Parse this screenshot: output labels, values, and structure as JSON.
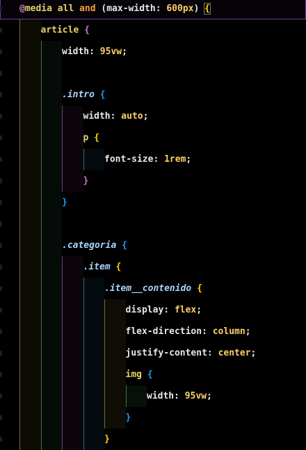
{
  "editor": {
    "lines": [
      {
        "indent": 0,
        "tokens": [
          {
            "t": "@",
            "c": "tk-at"
          },
          {
            "t": "media",
            "c": "tk-kw"
          },
          {
            "t": " ",
            "c": "tk-plain"
          },
          {
            "t": "all",
            "c": "tk-kw"
          },
          {
            "t": " ",
            "c": "tk-plain"
          },
          {
            "t": "and",
            "c": "tk-and"
          },
          {
            "t": " (",
            "c": "tk-plain"
          },
          {
            "t": "max-width",
            "c": "tk-prop"
          },
          {
            "t": ": ",
            "c": "tk-colon"
          },
          {
            "t": "600",
            "c": "tk-num"
          },
          {
            "t": "px",
            "c": "tk-num"
          },
          {
            "t": ") ",
            "c": "tk-plain"
          },
          {
            "t": "{",
            "c": "br-y br-highlight"
          }
        ],
        "active": true
      },
      {
        "indent": 1,
        "tokens": [
          {
            "t": "article",
            "c": "tk-tag"
          },
          {
            "t": " ",
            "c": "tk-plain"
          },
          {
            "t": "{",
            "c": "br-p"
          }
        ]
      },
      {
        "indent": 2,
        "tokens": [
          {
            "t": "width",
            "c": "tk-prop"
          },
          {
            "t": ": ",
            "c": "tk-colon"
          },
          {
            "t": "95vw",
            "c": "tk-num"
          },
          {
            "t": ";",
            "c": "tk-plain"
          }
        ]
      },
      {
        "indent": 2,
        "tokens": []
      },
      {
        "indent": 2,
        "tokens": [
          {
            "t": ".intro",
            "c": "tk-class"
          },
          {
            "t": " ",
            "c": "tk-plain"
          },
          {
            "t": "{",
            "c": "br-b"
          }
        ]
      },
      {
        "indent": 3,
        "tokens": [
          {
            "t": "width",
            "c": "tk-prop"
          },
          {
            "t": ": ",
            "c": "tk-colon"
          },
          {
            "t": "auto",
            "c": "tk-val"
          },
          {
            "t": ";",
            "c": "tk-plain"
          }
        ]
      },
      {
        "indent": 3,
        "tokens": [
          {
            "t": "p",
            "c": "tk-tag"
          },
          {
            "t": " ",
            "c": "tk-plain"
          },
          {
            "t": "{",
            "c": "br-y"
          }
        ]
      },
      {
        "indent": 4,
        "tokens": [
          {
            "t": "font-size",
            "c": "tk-prop"
          },
          {
            "t": ": ",
            "c": "tk-colon"
          },
          {
            "t": "1rem",
            "c": "tk-num"
          },
          {
            "t": ";",
            "c": "tk-plain"
          }
        ]
      },
      {
        "indent": 3,
        "tokens": [
          {
            "t": "}",
            "c": "br-p"
          }
        ]
      },
      {
        "indent": 2,
        "tokens": [
          {
            "t": "}",
            "c": "br-b"
          }
        ]
      },
      {
        "indent": 2,
        "tokens": []
      },
      {
        "indent": 2,
        "tokens": [
          {
            "t": ".categoria",
            "c": "tk-class"
          },
          {
            "t": " ",
            "c": "tk-plain"
          },
          {
            "t": "{",
            "c": "br-b"
          }
        ]
      },
      {
        "indent": 3,
        "tokens": [
          {
            "t": ".item",
            "c": "tk-class"
          },
          {
            "t": " ",
            "c": "tk-plain"
          },
          {
            "t": "{",
            "c": "br-y"
          }
        ]
      },
      {
        "indent": 4,
        "tokens": [
          {
            "t": ".item__contenido",
            "c": "tk-class"
          },
          {
            "t": " ",
            "c": "tk-plain"
          },
          {
            "t": "{",
            "c": "br-y"
          }
        ]
      },
      {
        "indent": 5,
        "tokens": [
          {
            "t": "display",
            "c": "tk-prop"
          },
          {
            "t": ": ",
            "c": "tk-colon"
          },
          {
            "t": "flex",
            "c": "tk-val"
          },
          {
            "t": ";",
            "c": "tk-plain"
          }
        ]
      },
      {
        "indent": 5,
        "tokens": [
          {
            "t": "flex-direction",
            "c": "tk-prop"
          },
          {
            "t": ": ",
            "c": "tk-colon"
          },
          {
            "t": "column",
            "c": "tk-val"
          },
          {
            "t": ";",
            "c": "tk-plain"
          }
        ]
      },
      {
        "indent": 5,
        "tokens": [
          {
            "t": "justify-content",
            "c": "tk-prop"
          },
          {
            "t": ": ",
            "c": "tk-colon"
          },
          {
            "t": "center",
            "c": "tk-val"
          },
          {
            "t": ";",
            "c": "tk-plain"
          }
        ]
      },
      {
        "indent": 5,
        "tokens": [
          {
            "t": "img",
            "c": "tk-tag"
          },
          {
            "t": " ",
            "c": "tk-plain"
          },
          {
            "t": "{",
            "c": "br-b"
          }
        ]
      },
      {
        "indent": 6,
        "tokens": [
          {
            "t": "width",
            "c": "tk-prop"
          },
          {
            "t": ": ",
            "c": "tk-colon"
          },
          {
            "t": "95vw",
            "c": "tk-num"
          },
          {
            "t": ";",
            "c": "tk-plain"
          }
        ]
      },
      {
        "indent": 5,
        "tokens": [
          {
            "t": "}",
            "c": "br-b"
          }
        ]
      },
      {
        "indent": 4,
        "tokens": [
          {
            "t": "}",
            "c": "br-y"
          }
        ]
      }
    ]
  }
}
